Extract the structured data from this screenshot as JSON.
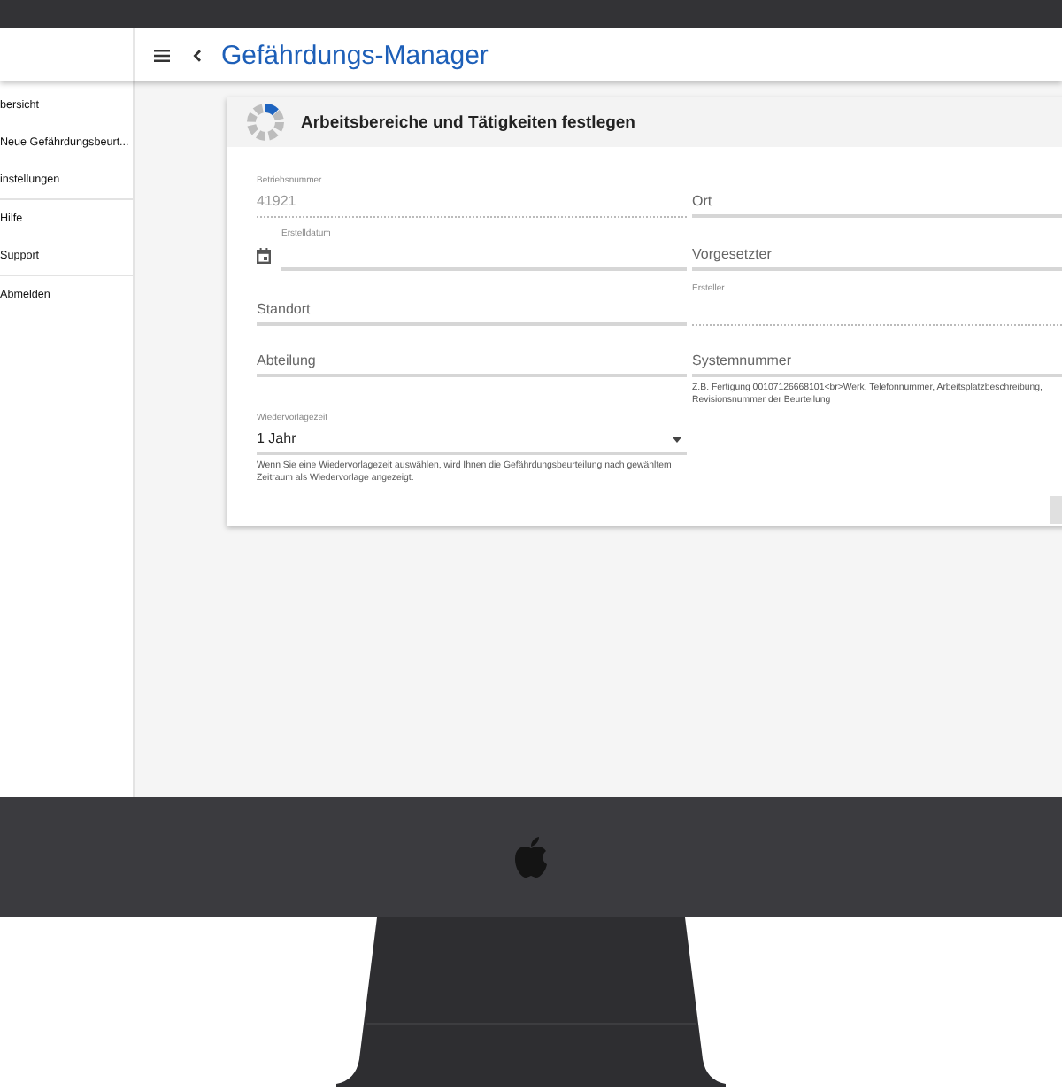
{
  "app": {
    "title": "Gefährdungs-Manager"
  },
  "sidebar": {
    "sections": [
      {
        "items": [
          "bersicht",
          "Neue Gefährdungsbeurt...",
          "instellungen"
        ]
      },
      {
        "items": [
          "Hilfe",
          "Support"
        ]
      },
      {
        "items": [
          "Abmelden"
        ]
      }
    ]
  },
  "card": {
    "title": "Arbeitsbereiche und Tätigkeiten festlegen",
    "progress": {
      "level": 0.125
    },
    "left": [
      {
        "kind": "text",
        "label": "Betriebsnummer",
        "value": "41921",
        "disabled": true
      },
      {
        "kind": "date",
        "label": "Erstelldatum",
        "disabled": false
      },
      {
        "kind": "text",
        "placeholder": "Standort",
        "disabled": false
      },
      {
        "kind": "text",
        "placeholder": "Abteilung",
        "disabled": false
      },
      {
        "kind": "select",
        "label": "Wiedervorlagezeit",
        "value": "1 Jahr",
        "disabled": false,
        "hint": "Wenn Sie eine Wiedervorlagezeit auswählen, wird Ihnen die Gefährdungsbeurteilung nach gewähltem Zeitraum als Wiedervorlage angezeigt."
      }
    ],
    "right": [
      {
        "kind": "text",
        "placeholder": "Ort",
        "disabled": false
      },
      {
        "kind": "text",
        "placeholder": "Vorgesetzter",
        "disabled": false
      },
      {
        "kind": "text",
        "label": "Ersteller",
        "disabled": true
      },
      {
        "kind": "text",
        "placeholder": "Systemnummer",
        "disabled": false,
        "hint": "Z.B. Fertigung 00107126668101<br>Werk, Telefonnummer, Arbeitsplatzbeschreibung, Revisionsnummer der Beurteilung"
      }
    ]
  }
}
